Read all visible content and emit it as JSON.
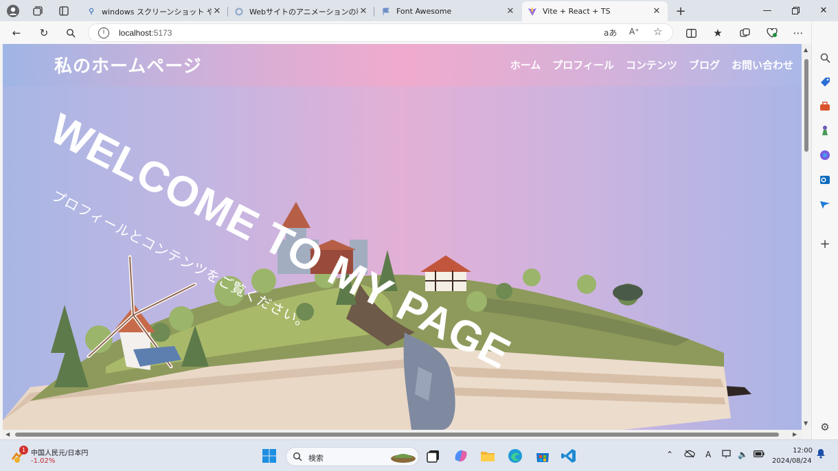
{
  "browser": {
    "tabs": [
      {
        "title": "windows スクリーンショット やり方 - 検",
        "favicon": "search-icon"
      },
      {
        "title": "Webサイトのアニメーションの種類と効",
        "favicon": "loading-icon"
      },
      {
        "title": "Font Awesome",
        "favicon": "flag-icon"
      },
      {
        "title": "Vite + React + TS",
        "favicon": "vite-icon"
      }
    ],
    "active_tab_index": 3,
    "address": {
      "host": "localhost",
      "port": ":5173"
    }
  },
  "site": {
    "logo": "私のホームページ",
    "nav": [
      "ホーム",
      "プロフィール",
      "コンテンツ",
      "ブログ",
      "お問い合わせ"
    ],
    "hero_title": "WELCOME TO MY PAGE",
    "hero_subtitle": "プロフィールとコンテンツをご覧ください。"
  },
  "taskbar": {
    "notification_count": "1",
    "ticker_name": "中国人民元/日本円",
    "ticker_change": "-1.02%",
    "search_placeholder": "検索",
    "time": "12:00",
    "date": "2024/08/24"
  },
  "colors": {
    "page_gradient": [
      "#a8b6e4",
      "#e3b0d6",
      "#aab5e6"
    ],
    "accent_ticker_down": "#c4262e",
    "notification_badge": "#d0312d"
  }
}
